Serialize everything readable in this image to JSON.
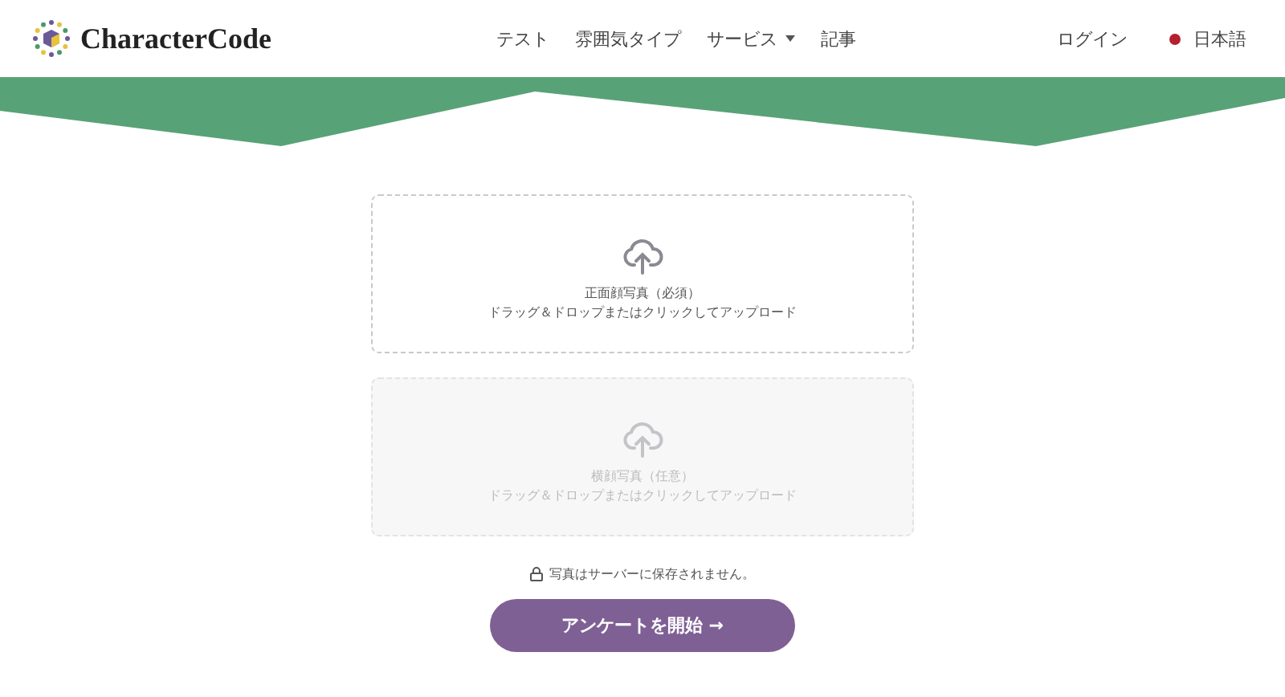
{
  "header": {
    "logo": "CharacterCode",
    "nav": [
      {
        "label": "テスト",
        "dropdown": false
      },
      {
        "label": "雰囲気タイプ",
        "dropdown": false
      },
      {
        "label": "サービス",
        "dropdown": true
      },
      {
        "label": "記事",
        "dropdown": false
      }
    ],
    "login": "ログイン",
    "language": "日本語"
  },
  "uploads": [
    {
      "title": "正面顔写真（必須）",
      "hint": "ドラッグ＆ドロップまたはクリックしてアップロード",
      "disabled": false
    },
    {
      "title": "横顔写真（任意）",
      "hint": "ドラッグ＆ドロップまたはクリックしてアップロード",
      "disabled": true
    }
  ],
  "privacy_note": "写真はサーバーに保存されません。",
  "start_button": "アンケートを開始 →"
}
